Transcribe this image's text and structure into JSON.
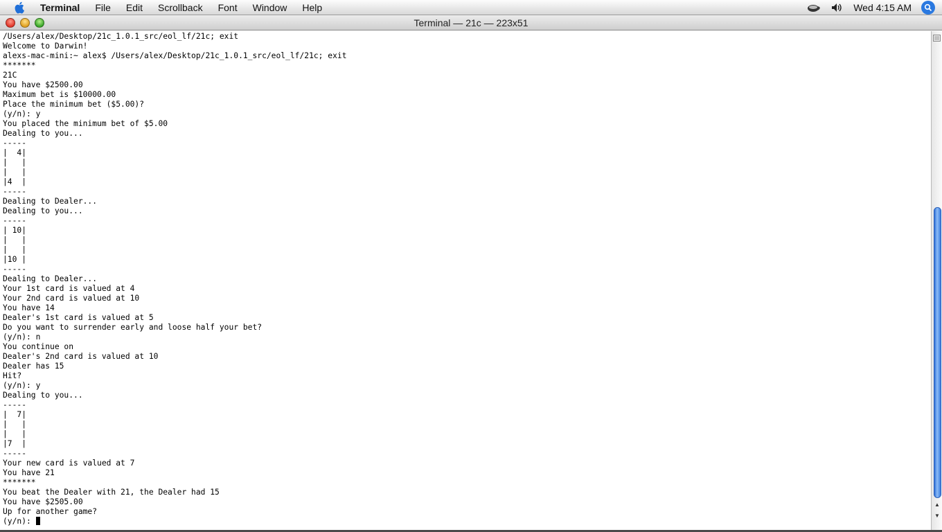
{
  "menubar": {
    "app_name": "Terminal",
    "items": [
      "File",
      "Edit",
      "Scrollback",
      "Font",
      "Window",
      "Help"
    ],
    "clock": "Wed 4:15 AM"
  },
  "window": {
    "title": "Terminal — 21c — 223x51"
  },
  "terminal": {
    "lines": [
      "/Users/alex/Desktop/21c_1.0.1_src/eol_lf/21c; exit",
      "Welcome to Darwin!",
      "alexs-mac-mini:~ alex$ /Users/alex/Desktop/21c_1.0.1_src/eol_lf/21c; exit",
      "*******",
      "21C",
      "You have $2500.00",
      "Maximum bet is $10000.00",
      "Place the minimum bet ($5.00)?",
      "(y/n): y",
      "You placed the minimum bet of $5.00",
      "Dealing to you...",
      "-----",
      "|  4|",
      "|   |",
      "|   |",
      "|4  |",
      "-----",
      "Dealing to Dealer...",
      "Dealing to you...",
      "-----",
      "| 10|",
      "|   |",
      "|   |",
      "|10 |",
      "-----",
      "Dealing to Dealer...",
      "Your 1st card is valued at 4",
      "Your 2nd card is valued at 10",
      "You have 14",
      "Dealer's 1st card is valued at 5",
      "Do you want to surrender early and loose half your bet?",
      "(y/n): n",
      "You continue on",
      "Dealer's 2nd card is valued at 10",
      "Dealer has 15",
      "Hit?",
      "(y/n): y",
      "Dealing to you...",
      "-----",
      "|  7|",
      "|   |",
      "|   |",
      "|7  |",
      "-----",
      "Your new card is valued at 7",
      "You have 21",
      "*******",
      "You beat the Dealer with 21, the Dealer had 15",
      "You have $2505.00",
      "Up for another game?"
    ],
    "prompt": "(y/n): "
  },
  "scrollbar": {
    "position_fraction": 0.35,
    "visible_fraction": 0.58
  },
  "colors": {
    "scroll_thumb": "#3b7ddf",
    "spotlight": "#2a79e0"
  }
}
